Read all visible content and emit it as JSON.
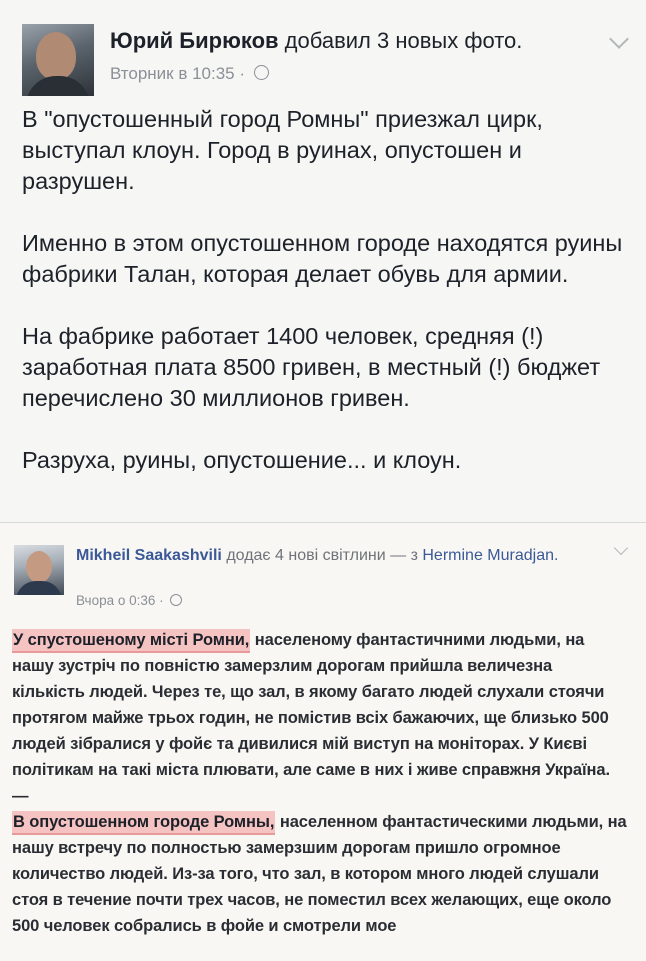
{
  "post": {
    "author": "Юрий Бирюков",
    "action": "добавил 3 новых фото.",
    "timestamp": "Вторник в 10:35",
    "separator": "·",
    "paragraphs": [
      "В \"опустошенный город Ромны\" приезжал цирк, выступал клоун. Город в руинах, опустошен и разрушен.",
      "Именно в этом опустошенном городе находятся руины фабрики Талан, которая  делает обувь для армии.",
      "На фабрике работает 1400 человек, средняя (!) заработная плата 8500 гривен, в местный (!) бюджет перечислено 30 миллионов гривен.",
      "Разруха, руины, опустошение... и клоун."
    ]
  },
  "shared": {
    "author": "Mikheil Saakashvili",
    "action": "додає 4 нові світлини — з",
    "tagged": "Hermine Muradjan.",
    "timestamp": "Вчора о 0:36",
    "separator": "·",
    "ukr_highlight": "У спустошеному місті Ромни,",
    "ukr_rest": " населеному фантастичними людьми, на нашу зустріч по повністю замерзлим дорогам прийшла величезна кількість людей. Через те, що зал, в якому багато людей слухали стоячи протягом майже трьох годин, не помістив всіх бажаючих, ще близько 500 людей зібралися у фойє та дивилися мій виступ на моніторах. У Києві політикам на такі міста плювати, але саме в них і живе справжня Україна.",
    "dash": "—",
    "rus_highlight": "В опустошенном городе Ромны,",
    "rus_rest": " населенном фантастическими людьми, на нашу встречу по полностью замерзшим дорогам пришло огромное количество людей. Из-за того, что зал, в котором много людей слушали стоя в течение почти трех часов, не поместил всех желающих, еще около 500 человек собрались в фойе и смотрели мое"
  },
  "icons": {
    "globe": "globe-icon",
    "chevron": "chevron-down-icon"
  }
}
